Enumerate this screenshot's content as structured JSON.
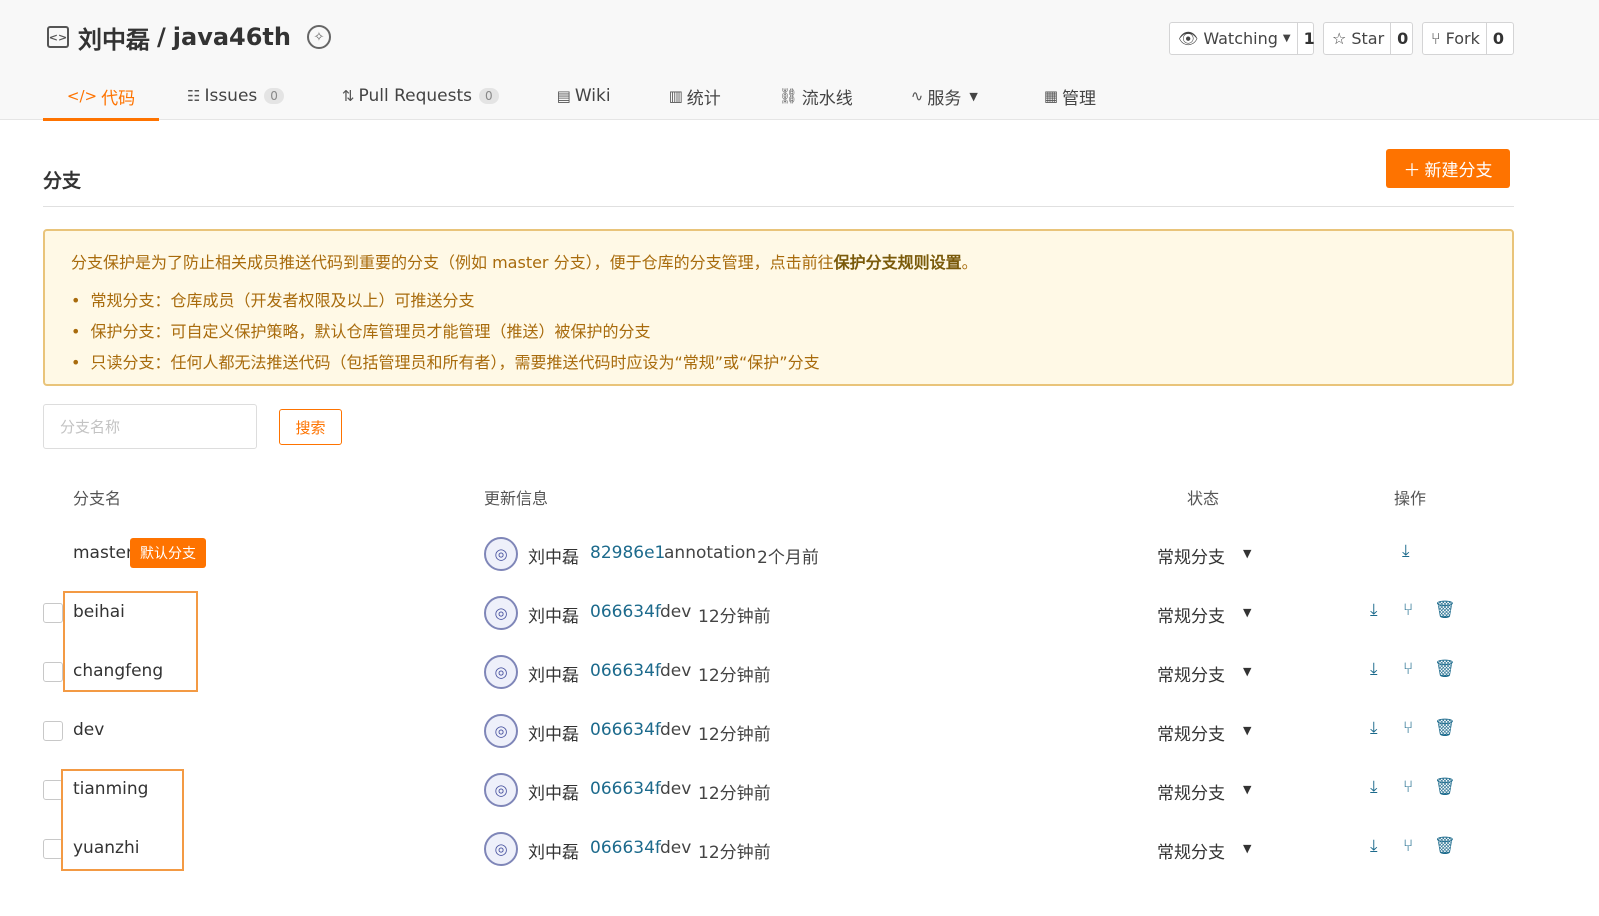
{
  "header": {
    "owner": "刘中磊",
    "separator": "/",
    "repo": "java46th",
    "watch": {
      "label": "Watching",
      "count": "1"
    },
    "star": {
      "label": "Star",
      "count": "0"
    },
    "fork": {
      "label": "Fork",
      "count": "0"
    }
  },
  "tabs": [
    {
      "label": "代码",
      "icon": "</>"
    },
    {
      "label": "Issues",
      "count": "0"
    },
    {
      "label": "Pull Requests",
      "count": "0"
    },
    {
      "label": "Wiki"
    },
    {
      "label": "统计"
    },
    {
      "label": "流水线"
    },
    {
      "label": "服务"
    },
    {
      "label": "管理"
    }
  ],
  "page": {
    "title": "分支",
    "new_branch_label": "新建分支"
  },
  "notice": {
    "intro": "分支保护是为了防止相关成员推送代码到重要的分支（例如 master 分支），便于仓库的分支管理，点击前往",
    "intro_link": "保护分支规则设置",
    "intro_end": "。",
    "items": [
      "常规分支：仓库成员（开发者权限及以上）可推送分支",
      "保护分支：可自定义保护策略，默认仓库管理员才能管理（推送）被保护的分支",
      "只读分支：任何人都无法推送代码（包括管理员和所有者），需要推送代码时应设为“常规”或“保护”分支"
    ]
  },
  "search": {
    "placeholder": "分支名称",
    "button": "搜索"
  },
  "table": {
    "headers": {
      "name": "分支名",
      "update": "更新信息",
      "status": "状态",
      "ops": "操作"
    },
    "rows": [
      {
        "name": "master",
        "tag": "默认分支",
        "author": "刘中磊",
        "sha": "82986e1",
        "message": "annotation",
        "time": "2个月前",
        "status": "常规分支"
      },
      {
        "name": "beihai",
        "author": "刘中磊",
        "sha": "066634f",
        "message": "dev",
        "time": "12分钟前",
        "status": "常规分支"
      },
      {
        "name": "changfeng",
        "author": "刘中磊",
        "sha": "066634f",
        "message": "dev",
        "time": "12分钟前",
        "status": "常规分支"
      },
      {
        "name": "dev",
        "author": "刘中磊",
        "sha": "066634f",
        "message": "dev",
        "time": "12分钟前",
        "status": "常规分支"
      },
      {
        "name": "tianming",
        "author": "刘中磊",
        "sha": "066634f",
        "message": "dev",
        "time": "12分钟前",
        "status": "常规分支"
      },
      {
        "name": "yuanzhi",
        "author": "刘中磊",
        "sha": "066634f",
        "message": "dev",
        "time": "12分钟前",
        "status": "常规分支"
      }
    ]
  },
  "colors": {
    "accent": "#fe7300",
    "link": "#1c6a8c",
    "notice_bg": "#fff9e6",
    "highlight": "#f39a44"
  }
}
